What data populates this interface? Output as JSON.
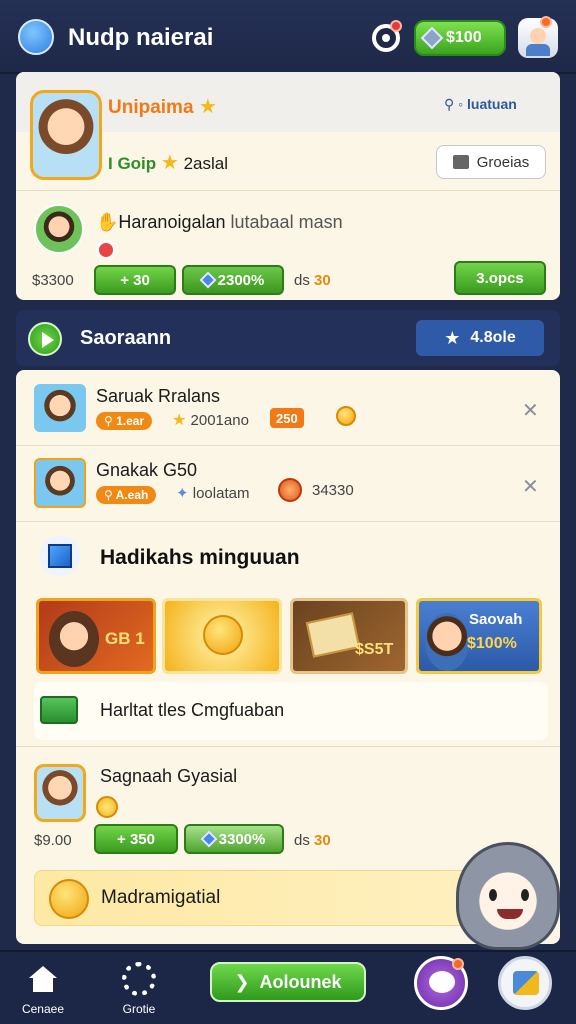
{
  "header": {
    "title": "Nudp naierai",
    "coin_balance": "$100",
    "icons": [
      "compass-icon",
      "target-icon",
      "gem-icon",
      "avatar-icon"
    ]
  },
  "profile_card": {
    "title": "Unipaima",
    "link": "⚲ ◦ luatuan",
    "subtitle_prefix": "I Goip",
    "subtitle_value": "2aslal",
    "button": "Groeias",
    "friend_name": "Haranoigalan",
    "friend_status": "lutabaal masn",
    "price": "$3300",
    "stat_plus": "+ 30",
    "stat_percent": "2300%",
    "extra_prefix": "ds",
    "extra_value": "30",
    "action": "3.opcs"
  },
  "section": {
    "title": "Saoraann",
    "badge": "4.8ole"
  },
  "list": [
    {
      "name": "Saruak Rralans",
      "tag": "⚲ 1.ear",
      "value": "2001ano",
      "badge": "250"
    },
    {
      "name": "Gnakak G50",
      "tag": "⚲ A.eah",
      "value": "loolatam",
      "badge": "34330"
    }
  ],
  "rewards": {
    "title": "Hadikahs minguuan",
    "tiles": [
      {
        "label": "GB 1"
      },
      {
        "label": ""
      },
      {
        "label": "$S5T"
      },
      {
        "title": "Saovah",
        "label": "$100%"
      }
    ],
    "promo": "Harltat tles Cmgfuaban"
  },
  "bottom_row": {
    "name": "Sagnaah Gyasial",
    "price": "$9.00",
    "stat_plus": "+ 350",
    "stat_percent": "3300%",
    "extra_prefix": "ds",
    "extra_value": "30"
  },
  "banner": {
    "text": "Madramigatial"
  },
  "nav": {
    "home": "Cenaee",
    "settings": "Grotie",
    "cta": "Aolounek"
  },
  "colors": {
    "background": "#1f2a4a",
    "card": "#fbf6e6",
    "accent_green": "#3aa51f",
    "accent_orange": "#f07a17",
    "accent_blue": "#2f5aa8"
  }
}
